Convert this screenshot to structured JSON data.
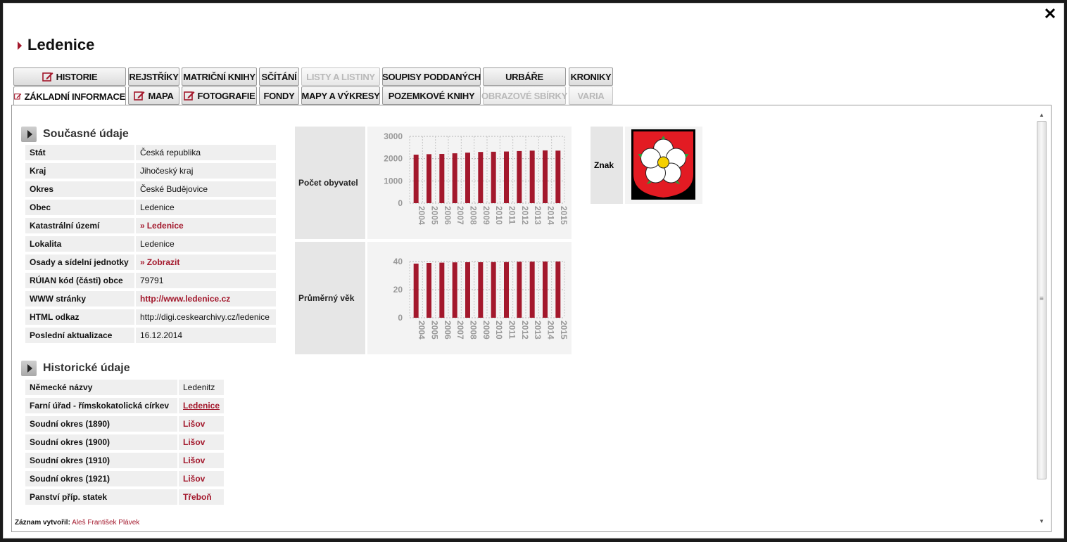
{
  "title": "Ledenice",
  "tabs_row1": [
    {
      "label": "HISTORIE",
      "icon": "edit-icon",
      "disabled": false
    },
    {
      "label": "REJSTŘÍKY",
      "disabled": false
    },
    {
      "label": "MATRIČNÍ KNIHY",
      "disabled": false
    },
    {
      "label": "SČÍTÁNÍ",
      "disabled": false
    },
    {
      "label": "LISTY A LISTINY",
      "disabled": true
    },
    {
      "label": "SOUPISY PODDANÝCH",
      "disabled": false
    },
    {
      "label": "URBÁŘE",
      "disabled": false
    },
    {
      "label": "KRONIKY",
      "disabled": false
    }
  ],
  "tabs_row2": [
    {
      "label": "ZÁKLADNÍ INFORMACE",
      "icon": "edit-icon",
      "active": true
    },
    {
      "label": "MAPA",
      "icon": "edit-icon"
    },
    {
      "label": "FOTOGRAFIE",
      "icon": "edit-icon"
    },
    {
      "label": "FONDY"
    },
    {
      "label": "MAPY A VÝKRESY"
    },
    {
      "label": "POZEMKOVÉ KNIHY"
    },
    {
      "label": "OBRAZOVÉ SBÍRKY",
      "disabled": true
    },
    {
      "label": "VARIA",
      "disabled": true
    }
  ],
  "current": {
    "heading": "Současné údaje",
    "rows": [
      {
        "key": "Stát",
        "value": "Česká republika"
      },
      {
        "key": "Kraj",
        "value": "Jihočeský kraj"
      },
      {
        "key": "Okres",
        "value": "České Budějovice"
      },
      {
        "key": "Obec",
        "value": "Ledenice"
      },
      {
        "key": "Katastrální území",
        "value": "Ledenice"
      },
      {
        "key": "Lokalita",
        "value": "Ledenice"
      },
      {
        "key": "Osady a sídelní jednotky",
        "value": "Zobrazit"
      },
      {
        "key": "RÚIAN kód (části) obce",
        "value": "79791"
      },
      {
        "key": "WWW stránky",
        "value": "http://www.ledenice.cz"
      },
      {
        "key": "HTML odkaz",
        "value": "http://digi.ceskearchivy.cz/ledenice"
      },
      {
        "key": "Poslední aktualizace",
        "value": "16.12.2014"
      }
    ]
  },
  "historic": {
    "heading": "Historické údaje",
    "rows": [
      {
        "key": "Německé názvy",
        "value": "Ledenitz"
      },
      {
        "key": "Farní úřad - římskokatolická církev",
        "value": "Ledenice"
      },
      {
        "key": "Soudní okres (1890)",
        "value": "Lišov"
      },
      {
        "key": "Soudní okres (1900)",
        "value": "Lišov"
      },
      {
        "key": "Soudní okres (1910)",
        "value": "Lišov"
      },
      {
        "key": "Soudní okres (1921)",
        "value": "Lišov"
      },
      {
        "key": "Panství příp. statek",
        "value": "Třeboň"
      }
    ]
  },
  "emblem": {
    "label": "Znak"
  },
  "footer": {
    "prefix": "Záznam vytvořil:",
    "author": "Aleš František Plávek"
  },
  "close_icon": "close-icon",
  "colors": {
    "accent": "#a3182c",
    "bar": "#a3182c"
  },
  "chart_data": [
    {
      "type": "bar",
      "title": "Počet obyvatel",
      "categories": [
        "2004",
        "2005",
        "2006",
        "2007",
        "2008",
        "2009",
        "2010",
        "2011",
        "2012",
        "2013",
        "2014",
        "2015"
      ],
      "values": [
        2180,
        2200,
        2210,
        2240,
        2270,
        2300,
        2310,
        2320,
        2340,
        2360,
        2370,
        2360
      ],
      "ylim": [
        0,
        3000
      ],
      "yticks": [
        0,
        1000,
        2000,
        3000
      ],
      "grid": true
    },
    {
      "type": "bar",
      "title": "Průměrný věk",
      "categories": [
        "2004",
        "2005",
        "2006",
        "2007",
        "2008",
        "2009",
        "2010",
        "2011",
        "2012",
        "2013",
        "2014",
        "2015"
      ],
      "values": [
        38.5,
        39,
        39.2,
        39.4,
        39.5,
        39.5,
        39.6,
        39.6,
        39.8,
        39.9,
        40,
        40
      ],
      "ylim": [
        0,
        40
      ],
      "yticks": [
        0,
        20,
        40
      ],
      "grid": true
    }
  ]
}
